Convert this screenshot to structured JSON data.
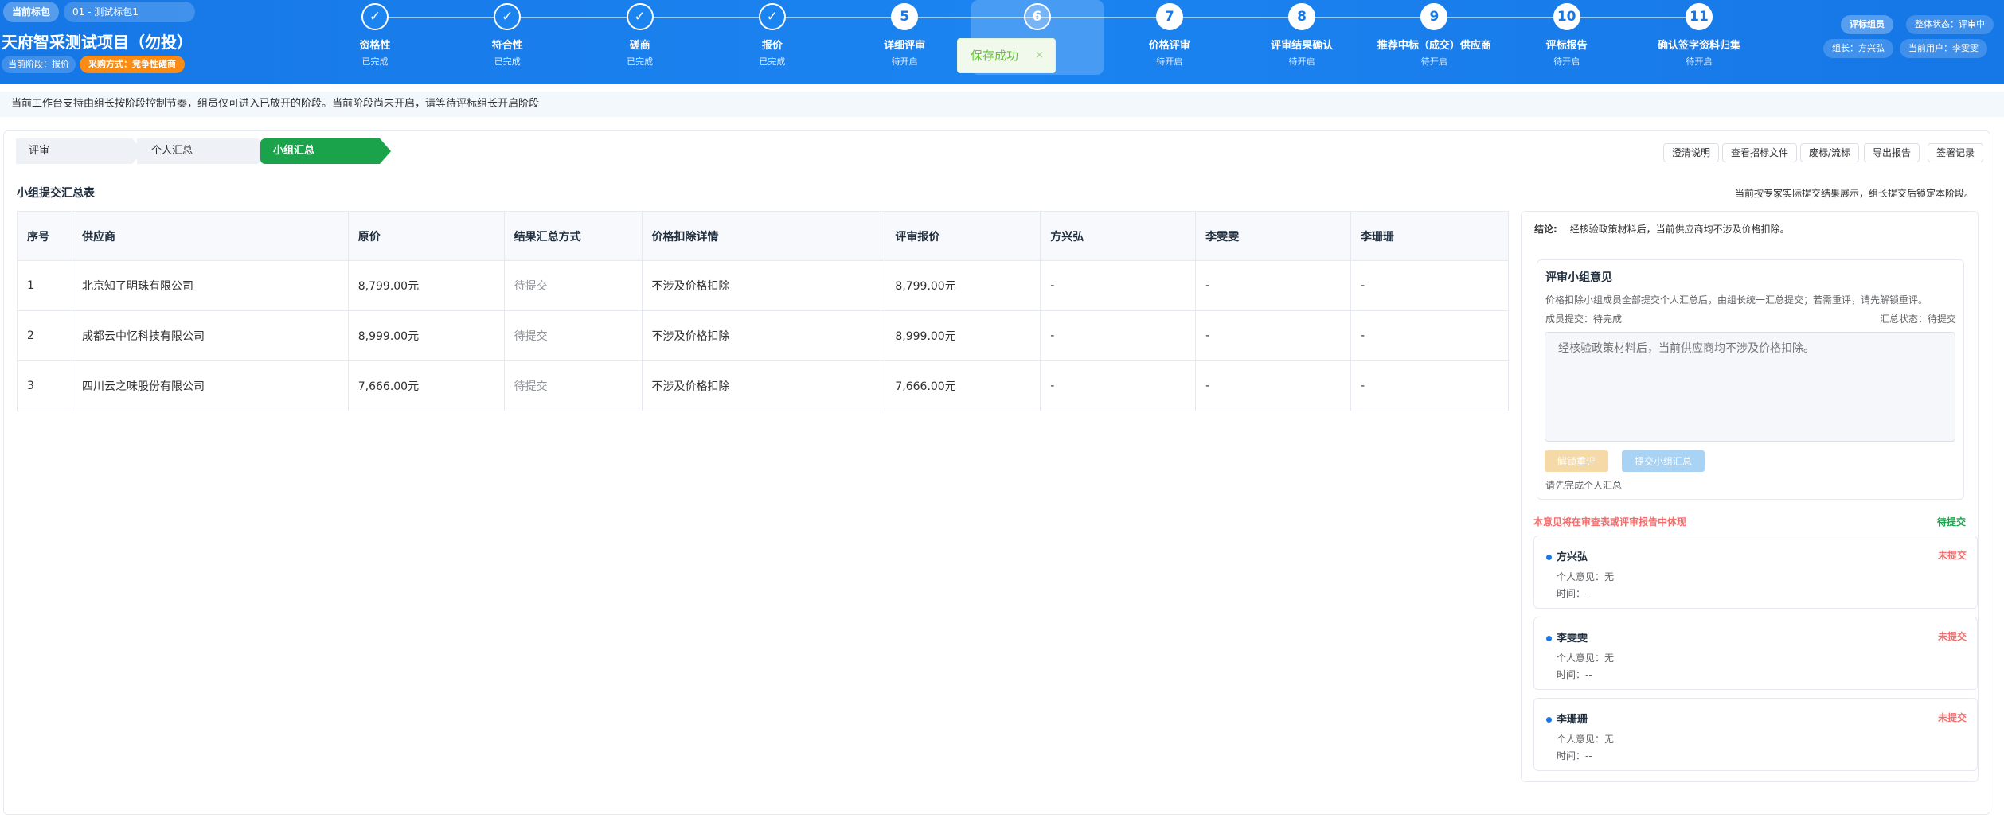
{
  "header": {
    "package_label": "当前标包",
    "package_value": "01 - 测试标包1",
    "project_title": "天府智采测试项目（勿投）",
    "stage_label": "当前阶段：报价",
    "method_label": "采购方式：竞争性磋商",
    "role_badge": "评标组员",
    "overall_status": "整体状态：评审中",
    "leader": "组长：方兴弘",
    "current_user": "当前用户：李雯雯"
  },
  "steps": [
    {
      "mark": "✓",
      "label": "资格性",
      "status": "已完成",
      "state": "done"
    },
    {
      "mark": "✓",
      "label": "符合性",
      "status": "已完成",
      "state": "done"
    },
    {
      "mark": "✓",
      "label": "磋商",
      "status": "已完成",
      "state": "done"
    },
    {
      "mark": "✓",
      "label": "报价",
      "status": "已完成",
      "state": "done"
    },
    {
      "mark": "5",
      "label": "详细评审",
      "status": "待开启",
      "state": "pending"
    },
    {
      "mark": "6",
      "label": "",
      "status": "",
      "state": "current"
    },
    {
      "mark": "7",
      "label": "价格评审",
      "status": "待开启",
      "state": "pending"
    },
    {
      "mark": "8",
      "label": "评审结果确认",
      "status": "待开启",
      "state": "pending"
    },
    {
      "mark": "9",
      "label": "推荐中标（成交）供应商",
      "status": "待开启",
      "state": "pending"
    },
    {
      "mark": "10",
      "label": "评标报告",
      "status": "待开启",
      "state": "pending"
    },
    {
      "mark": "11",
      "label": "确认签字资料归集",
      "status": "待开启",
      "state": "pending"
    }
  ],
  "toast": {
    "text": "保存成功",
    "close": "×"
  },
  "notice": "当前工作台支持由组长按阶段控制节奏，组员仅可进入已放开的阶段。当前阶段尚未开启，请等待评标组长开启阶段",
  "tabs": [
    "评审",
    "个人汇总",
    "小组汇总"
  ],
  "toolbar": [
    "澄清说明",
    "查看招标文件",
    "废标/流标",
    "导出报告",
    "签署记录"
  ],
  "section": {
    "title": "小组提交汇总表",
    "note": "当前按专家实际提交结果展示，组长提交后锁定本阶段。"
  },
  "table": {
    "headers": [
      "序号",
      "供应商",
      "原价",
      "结果汇总方式",
      "价格扣除详情",
      "评审报价",
      "方兴弘",
      "李雯雯",
      "李珊珊"
    ],
    "rows": [
      [
        "1",
        "北京知了明珠有限公司",
        "8,799.00元",
        "待提交",
        "不涉及价格扣除",
        "8,799.00元",
        "-",
        "-",
        "-"
      ],
      [
        "2",
        "成都云中忆科技有限公司",
        "8,999.00元",
        "待提交",
        "不涉及价格扣除",
        "8,999.00元",
        "-",
        "-",
        "-"
      ],
      [
        "3",
        "四川云之味股份有限公司",
        "7,666.00元",
        "待提交",
        "不涉及价格扣除",
        "7,666.00元",
        "-",
        "-",
        "-"
      ]
    ]
  },
  "panel": {
    "conclusion_label": "结论:",
    "conclusion_text": "经核验政策材料后，当前供应商均不涉及价格扣除。",
    "opinion_title": "评审小组意见",
    "opinion_desc": "价格扣除小组成员全部提交个人汇总后，由组长统一汇总提交；若需重评，请先解锁重评。",
    "member_submit": "成员提交：待完成",
    "summary_status": "汇总状态：待提交",
    "textarea_placeholder": "经核验政策材料后，当前供应商均不涉及价格扣除。",
    "reeval_button": "解锁重评",
    "submit_button": "提交小组汇总",
    "hint": "请先完成个人汇总",
    "report_note": "本意见将在审查表或评审报告中体现",
    "report_status": "待提交"
  },
  "members": [
    {
      "name": "方兴弘",
      "status": "未提交",
      "opinion": "个人意见：无",
      "time": "时间：--"
    },
    {
      "name": "李雯雯",
      "status": "未提交",
      "opinion": "个人意见：无",
      "time": "时间：--"
    },
    {
      "name": "李珊珊",
      "status": "未提交",
      "opinion": "个人意见：无",
      "time": "时间：--"
    }
  ]
}
